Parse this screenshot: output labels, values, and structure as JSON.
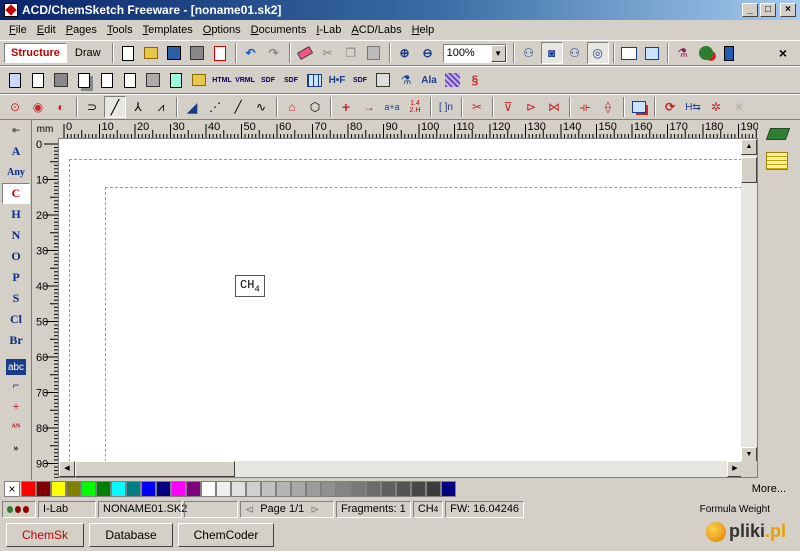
{
  "window": {
    "title": "ACD/ChemSketch Freeware - [noname01.sk2]",
    "min": "_",
    "max": "□",
    "close": "×"
  },
  "menu": [
    "File",
    "Edit",
    "Pages",
    "Tools",
    "Templates",
    "Options",
    "Documents",
    "I-Lab",
    "ACD/Labs",
    "Help"
  ],
  "toolbar": {
    "structure_label": "Structure",
    "draw_label": "Draw",
    "zoom_value": "100%",
    "close_doc": "×"
  },
  "toolbar2": {
    "html_label": "HTML",
    "vrml_label": "VRML",
    "sdf_label": "SDF",
    "sdf2_label": "SDF",
    "hf_label": "H•F",
    "ala_label": "Ala"
  },
  "toolbar3": {
    "arrow_label": "a+a",
    "fraction_top": "1.4",
    "fraction_bottom": "2.H",
    "bracket_label": "[ ]n"
  },
  "left_tools": [
    "A",
    "Any",
    "C",
    "H",
    "N",
    "O",
    "P",
    "S",
    "Cl",
    "Br"
  ],
  "left_tools_extra": {
    "abc": "abc",
    "more": "»"
  },
  "ruler": {
    "unit": "mm",
    "h_ticks": [
      "0",
      "10",
      "20",
      "30",
      "40",
      "50",
      "60",
      "70",
      "80",
      "90",
      "100",
      "110",
      "120",
      "130",
      "140",
      "150",
      "160",
      "170",
      "180",
      "190"
    ],
    "v_ticks": [
      "0",
      "10",
      "20",
      "30",
      "40",
      "50",
      "60",
      "70",
      "80",
      "90"
    ]
  },
  "canvas": {
    "molecule_main": "CH",
    "molecule_sub": "4"
  },
  "palette": {
    "none": "×",
    "colors": [
      "#ff0000",
      "#800000",
      "#ffff00",
      "#808000",
      "#00ff00",
      "#008000",
      "#00ffff",
      "#008080",
      "#0000ff",
      "#000080",
      "#ff00ff",
      "#800080",
      "#ffffff",
      "#f0f0f0",
      "#e0e0e0",
      "#d0d0d0",
      "#c0c0c0",
      "#b4b4b4",
      "#a8a8a8",
      "#9c9c9c",
      "#909090",
      "#848484",
      "#787878",
      "#6c6c6c",
      "#606060",
      "#545454",
      "#484848",
      "#3c3c3c",
      "#000080"
    ],
    "more_label": "More..."
  },
  "status": {
    "ilab": "I-Lab",
    "filename": "NONAME01.SK2",
    "page": "Page 1/1",
    "fragments": "Fragments: 1",
    "formula_main": "CH",
    "formula_sub": "4",
    "fw": "FW: 16.04246",
    "formula_weight_label": "Formula Weight"
  },
  "tabs": [
    "ChemSk",
    "Database",
    "ChemCoder"
  ],
  "watermark": {
    "text": "pliki",
    "suffix": ".pl"
  }
}
